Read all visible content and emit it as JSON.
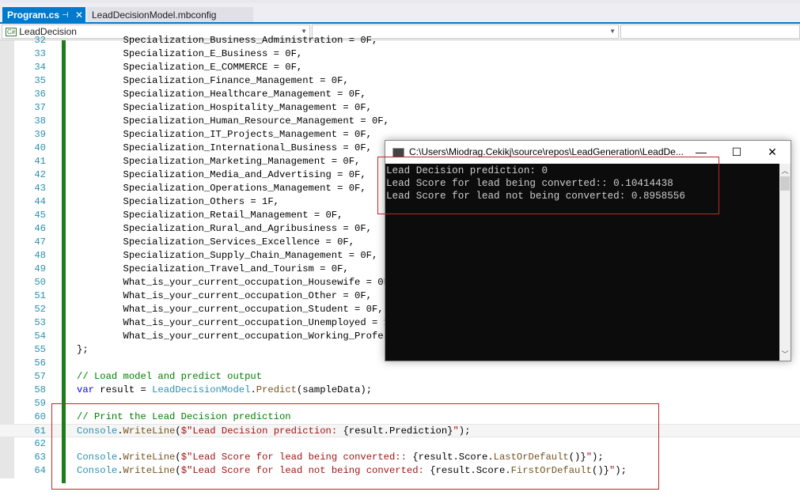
{
  "tabs": [
    {
      "label": "Program.cs",
      "active": true
    },
    {
      "label": "LeadDecisionModel.mbconfig",
      "active": false
    }
  ],
  "nav": {
    "project": "LeadDecision",
    "project_icon": "C#"
  },
  "code_lines": [
    {
      "num": "32",
      "seg": [
        [
          "pl",
          "        Specialization_Business_Administration = 0F,"
        ]
      ]
    },
    {
      "num": "33",
      "seg": [
        [
          "pl",
          "        Specialization_E_Business = 0F,"
        ]
      ]
    },
    {
      "num": "34",
      "seg": [
        [
          "pl",
          "        Specialization_E_COMMERCE = 0F,"
        ]
      ]
    },
    {
      "num": "35",
      "seg": [
        [
          "pl",
          "        Specialization_Finance_Management = 0F,"
        ]
      ]
    },
    {
      "num": "36",
      "seg": [
        [
          "pl",
          "        Specialization_Healthcare_Management = 0F,"
        ]
      ]
    },
    {
      "num": "37",
      "seg": [
        [
          "pl",
          "        Specialization_Hospitality_Management = 0F,"
        ]
      ]
    },
    {
      "num": "38",
      "seg": [
        [
          "pl",
          "        Specialization_Human_Resource_Management = 0F,"
        ]
      ]
    },
    {
      "num": "39",
      "seg": [
        [
          "pl",
          "        Specialization_IT_Projects_Management = 0F,"
        ]
      ]
    },
    {
      "num": "40",
      "seg": [
        [
          "pl",
          "        Specialization_International_Business = 0F,"
        ]
      ]
    },
    {
      "num": "41",
      "seg": [
        [
          "pl",
          "        Specialization_Marketing_Management = 0F,"
        ]
      ]
    },
    {
      "num": "42",
      "seg": [
        [
          "pl",
          "        Specialization_Media_and_Advertising = 0F,"
        ]
      ]
    },
    {
      "num": "43",
      "seg": [
        [
          "pl",
          "        Specialization_Operations_Management = 0F,"
        ]
      ]
    },
    {
      "num": "44",
      "seg": [
        [
          "pl",
          "        Specialization_Others = 1F,"
        ]
      ]
    },
    {
      "num": "45",
      "seg": [
        [
          "pl",
          "        Specialization_Retail_Management = 0F,"
        ]
      ]
    },
    {
      "num": "46",
      "seg": [
        [
          "pl",
          "        Specialization_Rural_and_Agribusiness = 0F,"
        ]
      ]
    },
    {
      "num": "47",
      "seg": [
        [
          "pl",
          "        Specialization_Services_Excellence = 0F,"
        ]
      ]
    },
    {
      "num": "48",
      "seg": [
        [
          "pl",
          "        Specialization_Supply_Chain_Management = 0F,"
        ]
      ]
    },
    {
      "num": "49",
      "seg": [
        [
          "pl",
          "        Specialization_Travel_and_Tourism = 0F,"
        ]
      ]
    },
    {
      "num": "50",
      "seg": [
        [
          "pl",
          "        What_is_your_current_occupation_Housewife = 0F,"
        ]
      ]
    },
    {
      "num": "51",
      "seg": [
        [
          "pl",
          "        What_is_your_current_occupation_Other = 0F,"
        ]
      ]
    },
    {
      "num": "52",
      "seg": [
        [
          "pl",
          "        What_is_your_current_occupation_Student = 0F,"
        ]
      ]
    },
    {
      "num": "53",
      "seg": [
        [
          "pl",
          "        What_is_your_current_occupation_Unemployed = 1F"
        ]
      ]
    },
    {
      "num": "54",
      "seg": [
        [
          "pl",
          "        What_is_your_current_occupation_Working_Profess"
        ]
      ]
    },
    {
      "num": "55",
      "seg": [
        [
          "pl",
          "};"
        ]
      ]
    },
    {
      "num": "56",
      "seg": []
    },
    {
      "num": "57",
      "seg": [
        [
          "cm",
          "// Load model and predict output"
        ]
      ]
    },
    {
      "num": "58",
      "seg": [
        [
          "kw",
          "var"
        ],
        [
          "pl",
          " result = "
        ],
        [
          "ty",
          "LeadDecisionModel"
        ],
        [
          "pl",
          "."
        ],
        [
          "me",
          "Predict"
        ],
        [
          "pl",
          "(sampleData);"
        ]
      ]
    },
    {
      "num": "59",
      "seg": []
    },
    {
      "num": "60",
      "seg": [
        [
          "cm",
          "// Print the Lead Decision prediction"
        ]
      ]
    },
    {
      "num": "61",
      "highlight": true,
      "seg": [
        [
          "ty",
          "Console"
        ],
        [
          "pl",
          "."
        ],
        [
          "me",
          "WriteLine"
        ],
        [
          "pl",
          "("
        ],
        [
          "st",
          "$\"Lead Decision prediction: "
        ],
        [
          "pl",
          "{result.Prediction}"
        ],
        [
          "st",
          "\""
        ],
        [
          "pl",
          ");"
        ]
      ]
    },
    {
      "num": "62",
      "seg": []
    },
    {
      "num": "63",
      "seg": [
        [
          "ty",
          "Console"
        ],
        [
          "pl",
          "."
        ],
        [
          "me",
          "WriteLine"
        ],
        [
          "pl",
          "("
        ],
        [
          "st",
          "$\"Lead Score for lead being converted:: "
        ],
        [
          "pl",
          "{result.Score."
        ],
        [
          "me",
          "LastOrDefault"
        ],
        [
          "pl",
          "()}"
        ],
        [
          "st",
          "\""
        ],
        [
          "pl",
          ");"
        ]
      ]
    },
    {
      "num": "64",
      "seg": [
        [
          "ty",
          "Console"
        ],
        [
          "pl",
          "."
        ],
        [
          "me",
          "WriteLine"
        ],
        [
          "pl",
          "("
        ],
        [
          "st",
          "$\"Lead Score for lead not being converted: "
        ],
        [
          "pl",
          "{result.Score."
        ],
        [
          "me",
          "FirstOrDefault"
        ],
        [
          "pl",
          "()}"
        ],
        [
          "st",
          "\""
        ],
        [
          "pl",
          ");"
        ]
      ]
    }
  ],
  "console": {
    "title": "C:\\Users\\Miodrag.Cekikj\\source\\repos\\LeadGeneration\\LeadDe...",
    "minimize": "—",
    "maximize": "☐",
    "close": "✕",
    "output": [
      "Lead Decision prediction: 0",
      "Lead Score for lead being converted:: 0.10414438",
      "Lead Score for lead not being converted: 0.8958556"
    ]
  },
  "colors": {
    "accent": "#007acc",
    "highlight_box": "#c0262c",
    "console_bg": "#0c0c0c"
  }
}
